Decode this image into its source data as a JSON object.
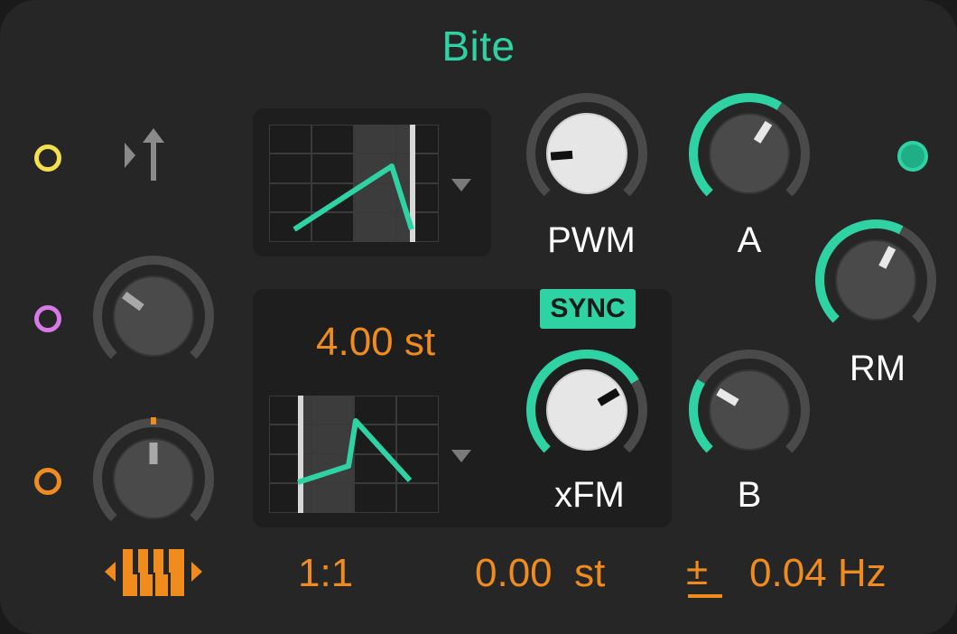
{
  "device": {
    "title": "Bite"
  },
  "colors": {
    "accent": "#2fd3a3",
    "orange": "#f08c1e",
    "panel": "#262626"
  },
  "ports": [
    {
      "name": "yellow-mod-port",
      "color": "#f4e04d"
    },
    {
      "name": "purple-mod-port",
      "color": "#d77ae8"
    },
    {
      "name": "orange-mod-port",
      "color": "#f08c1e"
    }
  ],
  "icons": {
    "trigger": "trigger-arrow-icon",
    "keyboard": "keyboard-range-icon",
    "dropdown": "dropdown-arrow-icon"
  },
  "knobs": {
    "pwm": {
      "label": "PWM",
      "value": 0.15
    },
    "a": {
      "label": "A",
      "value": 0.62
    },
    "rm": {
      "label": "RM",
      "value": 0.6
    },
    "xfm": {
      "label": "xFM",
      "value": 0.72
    },
    "b": {
      "label": "B",
      "value": 0.28
    },
    "left_mid": {
      "value": 0.3
    },
    "left_bottom": {
      "value": 0.5
    }
  },
  "sync": {
    "label": "SYNC",
    "active": true
  },
  "pitch": {
    "value": "4.00 st"
  },
  "bottom": {
    "ratio": "1:1",
    "fine": "0.00  st",
    "plus_minus": "±",
    "freq": "0.04 Hz"
  }
}
